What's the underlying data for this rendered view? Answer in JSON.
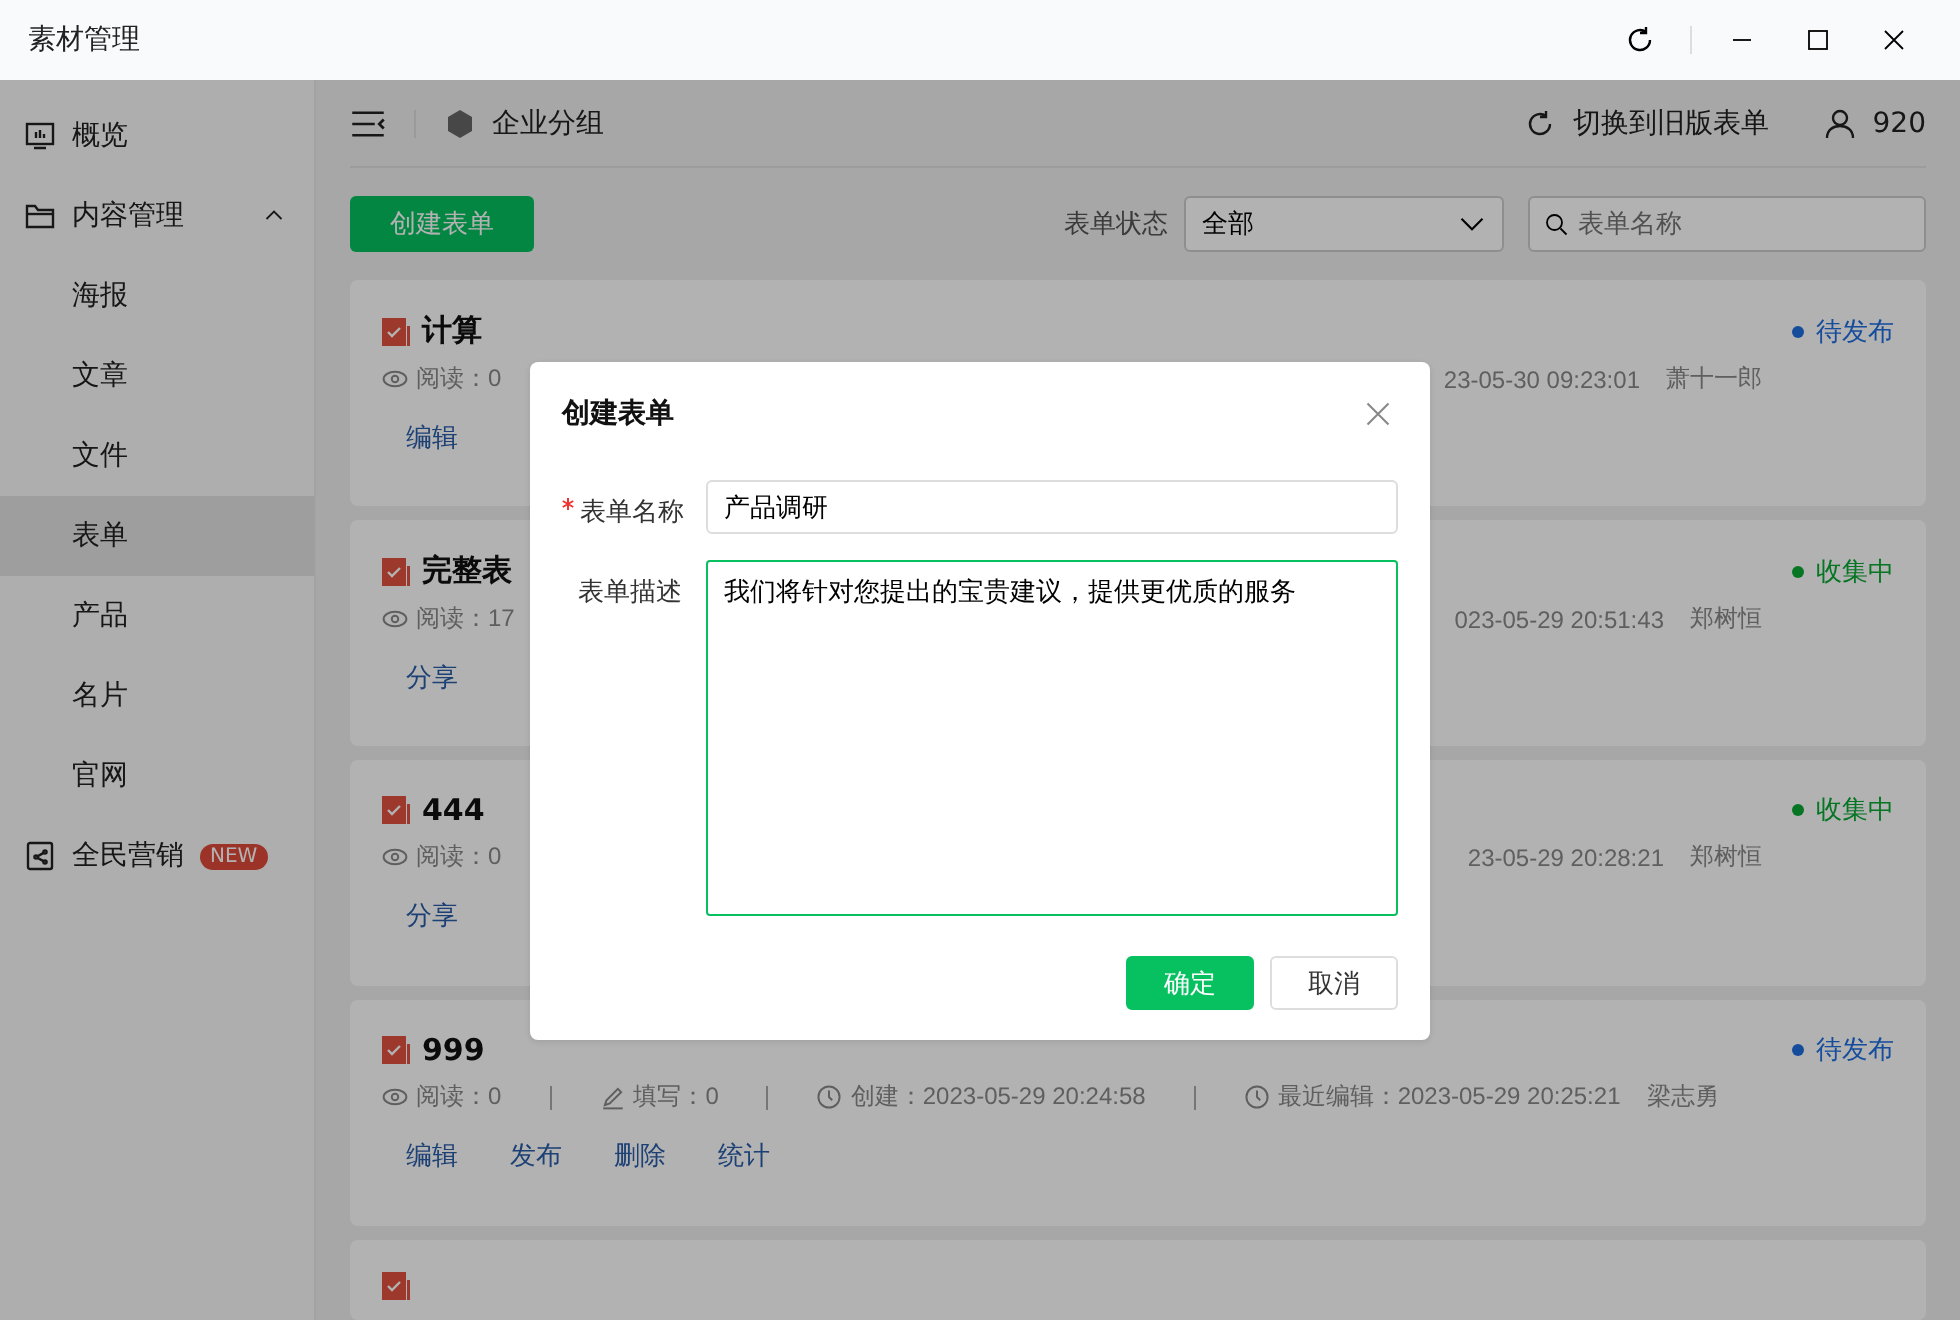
{
  "window": {
    "title": "素材管理"
  },
  "sidebar": {
    "items": [
      {
        "kind": "overview",
        "label": "概览",
        "selected": false
      },
      {
        "kind": "folder",
        "label": "内容管理",
        "selected": false,
        "expanded": true,
        "children": [
          {
            "label": "海报",
            "selected": false
          },
          {
            "label": "文章",
            "selected": false
          },
          {
            "label": "文件",
            "selected": false
          },
          {
            "label": "表单",
            "selected": true
          },
          {
            "label": "产品",
            "selected": false
          },
          {
            "label": "名片",
            "selected": false
          },
          {
            "label": "官网",
            "selected": false
          }
        ]
      },
      {
        "kind": "share",
        "label": "全民营销",
        "selected": false,
        "badge": "NEW"
      }
    ]
  },
  "topbar": {
    "group": "企业分组",
    "switch_label": "切换到旧版表单",
    "user_count": "920"
  },
  "toolbar": {
    "create_button": "创建表单",
    "status_label": "表单状态",
    "status_value": "全部",
    "search_placeholder": "表单名称"
  },
  "cards": [
    {
      "kind": "pending",
      "title": "计算",
      "status": "待发布",
      "meta": [
        {
          "kind": "read",
          "text": "阅读：0"
        }
      ],
      "tail": "23-05-30 09:23:01",
      "author": "萧十一郎",
      "actions": [
        "编辑"
      ]
    },
    {
      "kind": "collecting",
      "title": "完整表",
      "status": "收集中",
      "meta": [
        {
          "kind": "read",
          "text": "阅读：17"
        }
      ],
      "tail": "023-05-29 20:51:43",
      "author": "郑树恒",
      "actions": [
        "分享"
      ]
    },
    {
      "kind": "collecting",
      "title": "444",
      "status": "收集中",
      "meta": [
        {
          "kind": "read",
          "text": "阅读：0"
        }
      ],
      "tail": "23-05-29 20:28:21",
      "author": "郑树恒",
      "actions": [
        "分享"
      ]
    },
    {
      "kind": "pending",
      "title": "999",
      "status": "待发布",
      "meta": [
        {
          "kind": "read",
          "text": "阅读：0"
        },
        {
          "kind": "fill",
          "text": "填写：0"
        },
        {
          "kind": "time",
          "text": "创建：2023-05-29 20:24:58"
        },
        {
          "kind": "time",
          "text": "最近编辑：2023-05-29 20:25:21"
        }
      ],
      "author": "梁志勇",
      "actions": [
        "编辑",
        "发布",
        "删除",
        "统计"
      ]
    },
    {
      "kind": "cut"
    }
  ],
  "dialog": {
    "title": "创建表单",
    "fields": [
      {
        "kind": "input",
        "label": "表单名称",
        "required": true,
        "value": "产品调研",
        "focused": false
      },
      {
        "kind": "textarea",
        "label": "表单描述",
        "required": false,
        "value": "我们将针对您提出的宝贵建议，提供更优质的服务",
        "focused": true
      }
    ],
    "buttons": [
      {
        "kind": "primary",
        "label": "确定"
      },
      {
        "kind": "default",
        "label": "取消"
      }
    ]
  }
}
